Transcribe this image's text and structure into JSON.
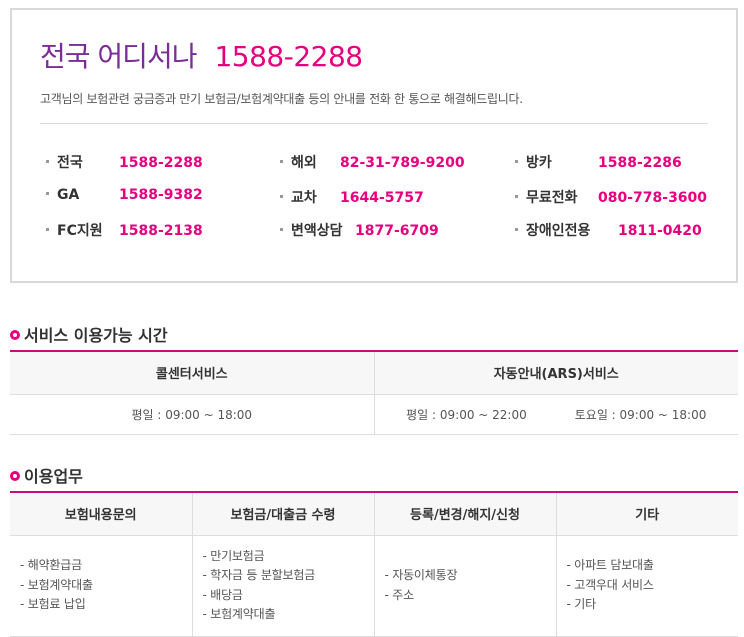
{
  "header": {
    "title": "전국 어디서나",
    "main_phone": "1588-2288",
    "description": "고객님의 보험관련 궁금증과 만기 보험금/보험계약대출 등의 안내를 전화 한 통으로 해결해드립니다."
  },
  "phones": [
    {
      "label": "전국",
      "number": "1588-2288"
    },
    {
      "label": "해외",
      "number": "82-31-789-9200"
    },
    {
      "label": "방카",
      "number": "1588-2286"
    },
    {
      "label": "GA",
      "number": "1588-9382"
    },
    {
      "label": "교차",
      "number": "1644-5757"
    },
    {
      "label": "무료전화",
      "number": "080-778-3600"
    },
    {
      "label": "FC지원",
      "number": "1588-2138"
    },
    {
      "label": "변액상담",
      "number": "1877-6709"
    },
    {
      "label": "장애인전용",
      "number": "1811-0420"
    }
  ],
  "hours": {
    "title": "서비스 이용가능 시간",
    "headers": [
      "콜센터서비스",
      "자동안내(ARS)서비스"
    ],
    "callcenter": "평일 : 09:00 ~ 18:00",
    "ars_weekday": "평일 : 09:00 ~ 22:00",
    "ars_saturday": "토요일 : 09:00 ~ 18:00"
  },
  "work": {
    "title": "이용업무",
    "headers": [
      "보험내용문의",
      "보험금/대출금 수령",
      "등록/변경/해지/신청",
      "기타"
    ],
    "columns": [
      [
        "- 해약환급금",
        "- 보험계약대출",
        "- 보험료 납입"
      ],
      [
        "- 만기보험금",
        "- 학자금 등 분할보험금",
        "- 배당금",
        "- 보험계약대출"
      ],
      [
        "- 자동이체통장",
        "- 주소"
      ],
      [
        "- 아파트 담보대출",
        "- 고객우대 서비스",
        "- 기타"
      ]
    ]
  },
  "colors": {
    "brand_purple": "#7a2d96",
    "accent_pink": "#e4007f",
    "section_line": "#cc0a7f"
  }
}
